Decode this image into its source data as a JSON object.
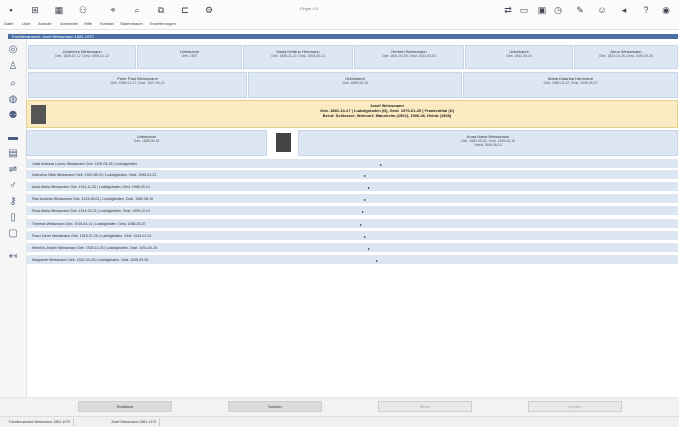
{
  "window": {
    "title": "Finger 4.0"
  },
  "menubar": [
    "Datei",
    "Liste",
    "Ansicht",
    "Anmelden",
    "Hilfe",
    "Kontakt",
    "Stammbaum",
    "Erweiterungen"
  ],
  "toolbar_icons": [
    "save-icon",
    "tree-icon",
    "grid-icon",
    "people-icon",
    "tool-icon",
    "search-icon",
    "copy-icon",
    "link-icon",
    "settings-icon"
  ],
  "toolbar_right_icons": [
    "share-icon",
    "page-icon",
    "photo-icon",
    "chart-icon",
    "edit-icon",
    "person-icon",
    "back-icon",
    "help-icon",
    "user-icon"
  ],
  "left_rail_icons": [
    "globe-icon",
    "person-icon",
    "search-icon",
    "layers-icon",
    "people-icon",
    "card-icon",
    "folder-icon",
    "shuffle-icon",
    "gender-icon",
    "key-icon",
    "doc-icon",
    "map-icon",
    "arrow-left-icon"
  ],
  "panel_header": "Familienansicht: Josef Weissmann 1881-1970",
  "grandparents": [
    {
      "name": "Johannes Weissmann",
      "dates": "Geb. 1836-07-12, Gest. 1906-01-12"
    },
    {
      "name": "Unbekannt",
      "dates": "Geb. 1837"
    },
    {
      "name": "Maria Kristina Herrmann",
      "dates": "Geb. 1838-11-22, Gest. 1908-05-13"
    },
    {
      "name": "Herbert Weissmann",
      "dates": "Geb. 1841-04-03, Gest. 1921-03-04"
    },
    {
      "name": "Unbekannt",
      "dates": "Geb. 1842-05-10"
    },
    {
      "name": "Anna Weissmann",
      "dates": "Geb. 1843-10-28, Gest. 1920-09-26"
    }
  ],
  "parents": [
    {
      "name": "Peter Paul Weissmann",
      "dates": "Geb. 1856-01-17, Gest. 1927-05-13"
    },
    {
      "name": "Unbekannt",
      "dates": "Geb. 1858-08-16"
    },
    {
      "name": "Maria Katarina Herrmann",
      "dates": "Geb. 1860-03-12, Gest. 1935-06-07"
    }
  ],
  "focus": {
    "name": "Josef Weissmann",
    "line1": "Geb. 1881-10-27 | Ludwigshafen (D), Gest. 1970-01-25 | Frankenthal (D)",
    "line2": "Beruf: Schlosser, Wohnort: Mannheim (1902), 1906-06, Heirat (1908)"
  },
  "spouse_row": [
    {
      "name": "Unbekannt",
      "dates": "Geb. 1885-06-18"
    },
    {
      "name": "Anna Maria Weissmann",
      "dates": "Geb. 1884-09-02, Gest. 1945-06-19",
      "extra": "Heirat 1906-06-14"
    }
  ],
  "children": [
    "Josef Andreas Lorenz Weissmann Geb. 1909-05-18 | Ludwigshafen",
    "Katharina Hilde Weissmann Geb. 1910-08-09 | Ludwigshafen, Gest. 1995-02-23",
    "Anna Maria Weissmann Geb. 1911-11-30 | Ludwigshafen, Gest. 1998-03-14",
    "Paul Andreas Weissmann Geb. 1913-06-02 | Ludwigshafen, Gest. 1982-08-19",
    "Rosa Maria Weissmann Geb. 1914-09-21 | Ludwigshafen, Gest. 1999-12-01",
    "Theresia Weissmann Geb. 1916-03-11 | Ludwigshafen, Gest. 1988-05-27",
    "Franz Xaver Weissmann Geb. 1918-07-25 | Ludwigshafen, Gest. 1944-01-10",
    "Heinrich Joseph Weissmann Geb. 1920-11-03 | Ludwigshafen, Gest. 2001-04-15",
    "Margarete Weissmann Geb. 1922-02-28 | Ludwigshafen, Gest. 2005-09-09"
  ],
  "buttons": [
    {
      "label": "Relations",
      "disabled": false
    },
    {
      "label": "Notizen",
      "disabled": false
    },
    {
      "label": "Bilder",
      "disabled": true
    },
    {
      "label": "Quellen",
      "disabled": true
    }
  ],
  "status_tabs": [
    "Familienansicht Weissmann 1881-1970",
    "Josef Weissmann 1881-1970"
  ]
}
